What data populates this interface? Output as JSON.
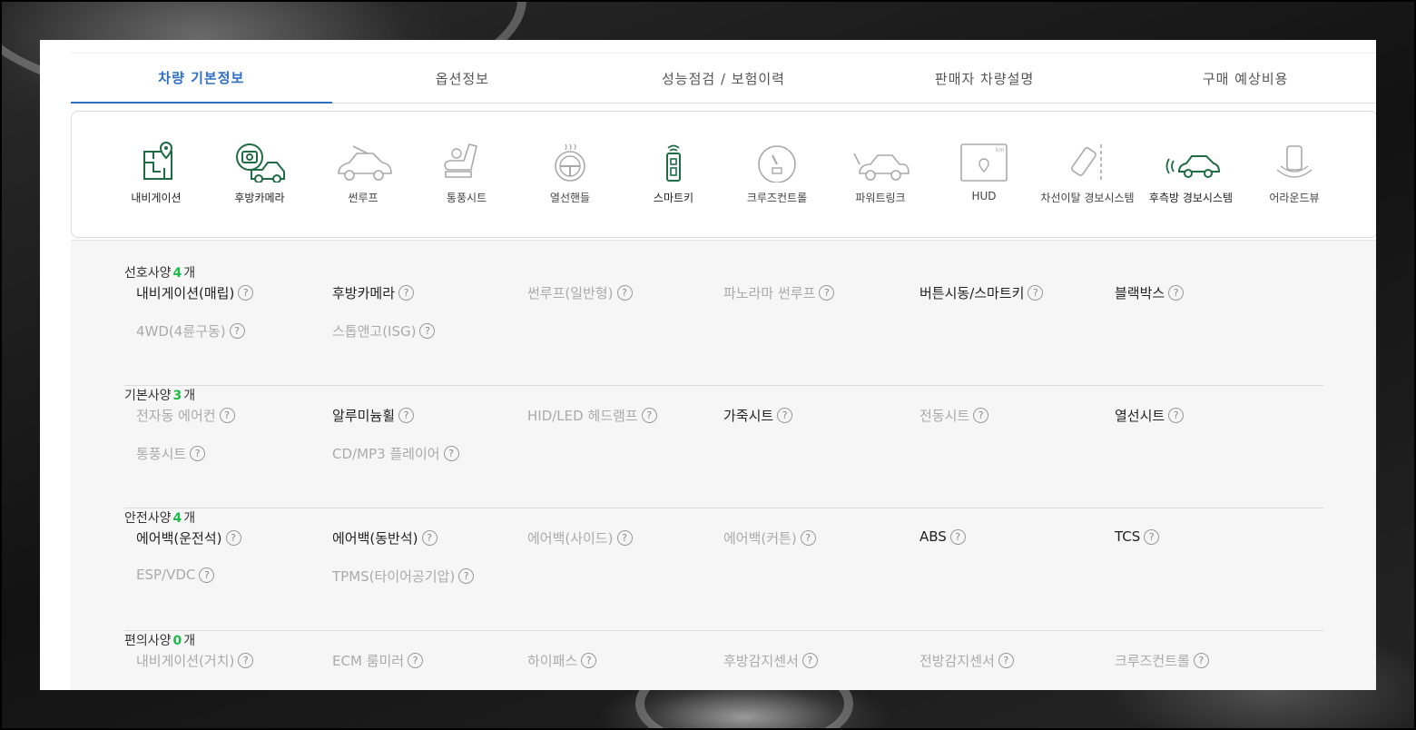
{
  "tabs": [
    {
      "label": "차량 기본정보"
    },
    {
      "label": "옵션정보"
    },
    {
      "label": "성능점검 / 보험이력"
    },
    {
      "label": "판매자 차량설명"
    },
    {
      "label": "구매 예상비용"
    }
  ],
  "options": [
    {
      "label": "내비게이션",
      "icon": "navigation-icon",
      "state": "on"
    },
    {
      "label": "후방카메라",
      "icon": "rear-camera-icon",
      "state": "on"
    },
    {
      "label": "썬루프",
      "icon": "sunroof-icon",
      "state": "off"
    },
    {
      "label": "통풍시트",
      "icon": "ventilated-seat-icon",
      "state": "off"
    },
    {
      "label": "열선핸들",
      "icon": "heated-steering-icon",
      "state": "off"
    },
    {
      "label": "스마트키",
      "icon": "smart-key-icon",
      "state": "on"
    },
    {
      "label": "크루즈컨트롤",
      "icon": "cruise-control-icon",
      "state": "off"
    },
    {
      "label": "파워트링크",
      "icon": "power-trunk-icon",
      "state": "off"
    },
    {
      "label": "HUD",
      "icon": "hud-icon",
      "state": "off"
    },
    {
      "label": "차선이탈 경보시스템",
      "icon": "lane-departure-icon",
      "state": "off"
    },
    {
      "label": "후측방 경보시스템",
      "icon": "blind-spot-icon",
      "state": "on"
    },
    {
      "label": "어라운드뷰",
      "icon": "around-view-icon",
      "state": "off"
    }
  ],
  "groups": [
    {
      "title": "선호사양",
      "count": "4",
      "unit": "개",
      "items": [
        {
          "label": "내비게이션(매립)",
          "on": true
        },
        {
          "label": "후방카메라",
          "on": true
        },
        {
          "label": "썬루프(일반형)",
          "on": false
        },
        {
          "label": "파노라마 썬루프",
          "on": false
        },
        {
          "label": "버튼시동/스마트키",
          "on": true
        },
        {
          "label": "블랙박스",
          "on": true
        },
        {
          "label": "4WD(4륜구동)",
          "on": false
        },
        {
          "label": "스톱앤고(ISG)",
          "on": false
        }
      ]
    },
    {
      "title": "기본사양",
      "count": "3",
      "unit": "개",
      "items": [
        {
          "label": "전자동 에어컨",
          "on": false
        },
        {
          "label": "알루미늄휠",
          "on": true
        },
        {
          "label": "HID/LED 헤드램프",
          "on": false
        },
        {
          "label": "가죽시트",
          "on": true
        },
        {
          "label": "전동시트",
          "on": false
        },
        {
          "label": "열선시트",
          "on": true
        },
        {
          "label": "통풍시트",
          "on": false
        },
        {
          "label": "CD/MP3 플레이어",
          "on": false
        }
      ]
    },
    {
      "title": "안전사양",
      "count": "4",
      "unit": "개",
      "items": [
        {
          "label": "에어백(운전석)",
          "on": true
        },
        {
          "label": "에어백(동반석)",
          "on": true
        },
        {
          "label": "에어백(사이드)",
          "on": false
        },
        {
          "label": "에어백(커튼)",
          "on": false
        },
        {
          "label": "ABS",
          "on": true
        },
        {
          "label": "TCS",
          "on": true
        },
        {
          "label": "ESP/VDC",
          "on": false
        },
        {
          "label": "TPMS(타이어공기압)",
          "on": false
        }
      ]
    },
    {
      "title": "편의사양",
      "count": "0",
      "unit": "개",
      "items": [
        {
          "label": "내비게이션(거치)",
          "on": false
        },
        {
          "label": "ECM 룸미러",
          "on": false
        },
        {
          "label": "하이패스",
          "on": false
        },
        {
          "label": "후방감지센서",
          "on": false
        },
        {
          "label": "전방감지센서",
          "on": false
        },
        {
          "label": "크루즈컨트롤",
          "on": false
        }
      ]
    }
  ],
  "colors": {
    "accent": "#2f6fc4",
    "count": "#1db94a",
    "icon_on": "#1f6b46",
    "icon_off": "#a8a8a8"
  }
}
